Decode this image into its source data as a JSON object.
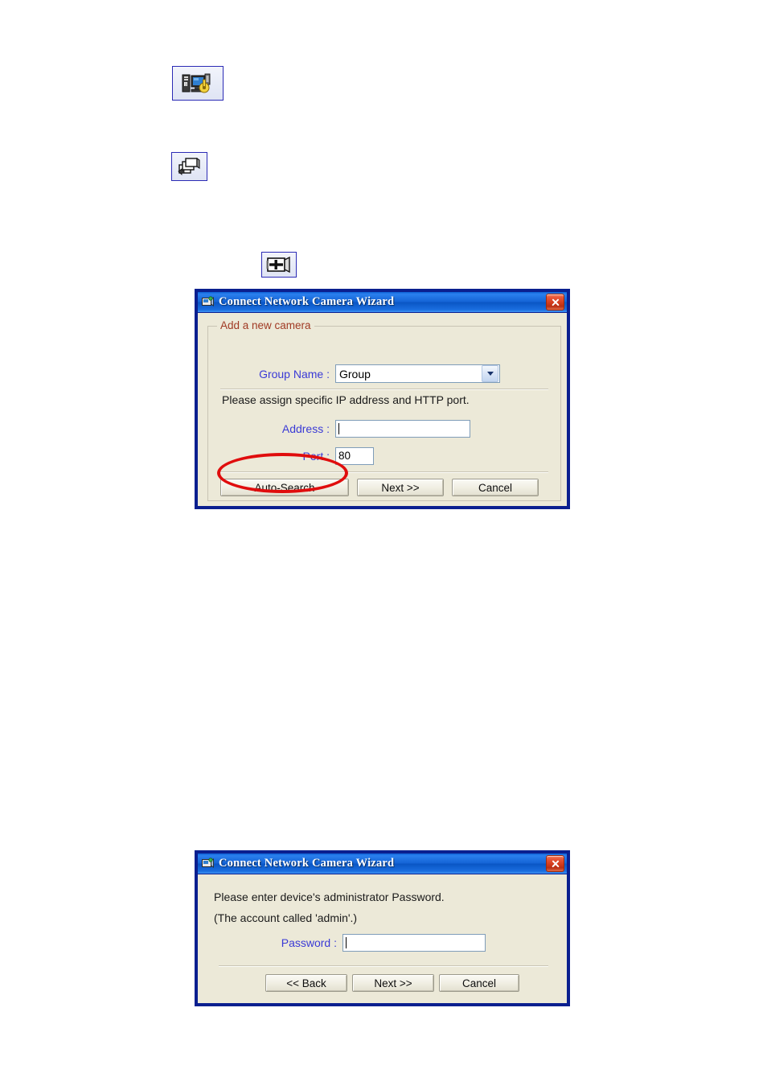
{
  "page": {
    "background": "#ffffff",
    "accent_blue": "#3a3ad6",
    "groupbox_title_color": "#a03a24",
    "annotation_color": "#e00d0d",
    "dialog_face": "#ece9d8",
    "title_bar_blue": "#1564d6"
  },
  "icons": [
    {
      "name": "server-security-icon",
      "alt": "Server and monitor with key"
    },
    {
      "name": "multi-screen-icon",
      "alt": "Stacked screens"
    },
    {
      "name": "add-camera-icon",
      "alt": "Camera with plus sign"
    }
  ],
  "dialog_add_camera": {
    "title": "Connect Network Camera Wizard",
    "title_icon": "camera-wizard-icon",
    "close_label": "Close",
    "groupbox_title": "Add a new camera",
    "group_name_label": "Group Name :",
    "group_name_value": "Group",
    "group_name_options": [
      "Group"
    ],
    "instruction": "Please assign specific IP address and HTTP port.",
    "address_label": "Address :",
    "address_value": "",
    "address_placeholder": "",
    "port_label": "Port :",
    "port_value": "80",
    "buttons": {
      "auto_search": "Auto-Search",
      "next": "Next >>",
      "cancel": "Cancel"
    },
    "highlighted_button": "Auto-Search"
  },
  "dialog_password": {
    "title": "Connect Network Camera Wizard",
    "title_icon": "camera-wizard-icon",
    "close_label": "Close",
    "line1": "Please enter device's administrator Password.",
    "line2": "(The account called 'admin'.)",
    "password_label": "Password :",
    "password_value": "",
    "buttons": {
      "back": "<< Back",
      "next": "Next >>",
      "cancel": "Cancel"
    }
  }
}
